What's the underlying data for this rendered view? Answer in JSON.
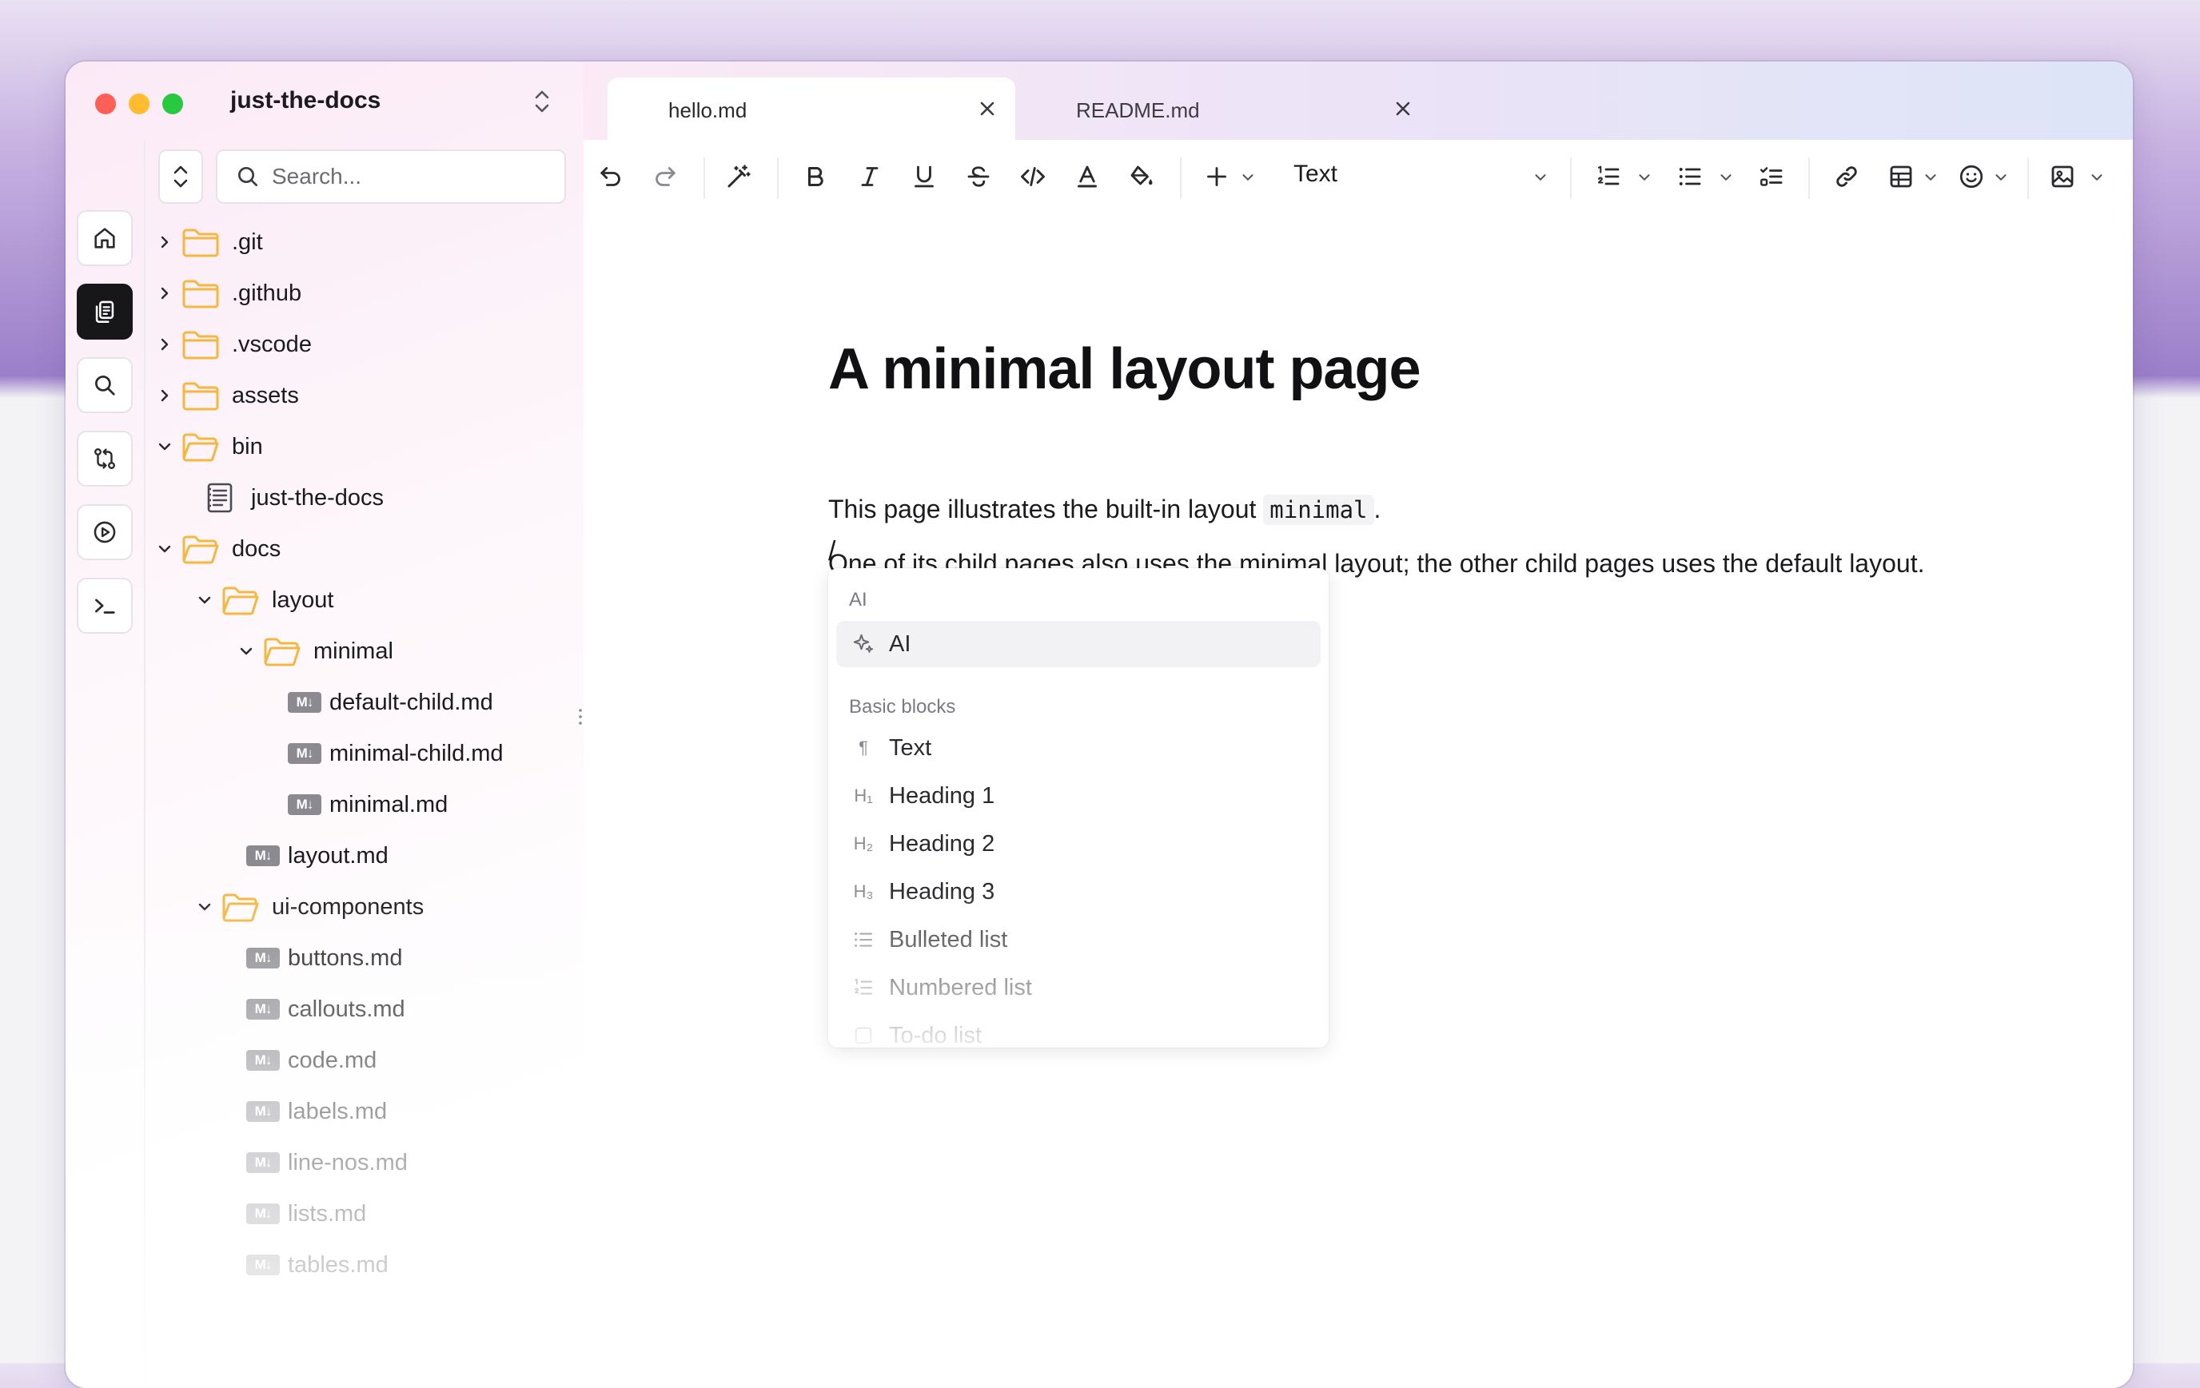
{
  "workspace": {
    "name": "just-the-docs"
  },
  "search": {
    "placeholder": "Search..."
  },
  "tree": [
    {
      "label": ".git",
      "type": "folder",
      "expanded": false
    },
    {
      "label": ".github",
      "type": "folder",
      "expanded": false
    },
    {
      "label": ".vscode",
      "type": "folder",
      "expanded": false
    },
    {
      "label": "assets",
      "type": "folder",
      "expanded": false
    },
    {
      "label": "bin",
      "type": "folder",
      "expanded": true
    },
    {
      "label": "just-the-docs",
      "type": "file"
    },
    {
      "label": "docs",
      "type": "folder",
      "expanded": true
    },
    {
      "label": "layout",
      "type": "folder",
      "expanded": true
    },
    {
      "label": "minimal",
      "type": "folder",
      "expanded": true
    },
    {
      "label": "default-child.md",
      "type": "md"
    },
    {
      "label": "minimal-child.md",
      "type": "md"
    },
    {
      "label": "minimal.md",
      "type": "md"
    },
    {
      "label": "layout.md",
      "type": "md"
    },
    {
      "label": "ui-components",
      "type": "folder",
      "expanded": true
    },
    {
      "label": "buttons.md",
      "type": "md"
    },
    {
      "label": "callouts.md",
      "type": "md"
    },
    {
      "label": "code.md",
      "type": "md"
    },
    {
      "label": "labels.md",
      "type": "md"
    },
    {
      "label": "line-nos.md",
      "type": "md"
    },
    {
      "label": "lists.md",
      "type": "md"
    },
    {
      "label": "tables.md",
      "type": "md"
    }
  ],
  "md_badge": "M↓",
  "tabs": [
    {
      "label": "hello.md",
      "active": true
    },
    {
      "label": "README.md",
      "active": false
    }
  ],
  "toolbar": {
    "block_type": "Text"
  },
  "document": {
    "title": "A minimal layout page",
    "p1_before": "This page illustrates the built-in layout ",
    "p1_code": "minimal",
    "p1_after": ".",
    "p2": "One of its child pages also uses the minimal layout; the other child pages uses the default layout.",
    "slash": "/"
  },
  "slash_menu": {
    "group_ai": "AI",
    "ai_item": "AI",
    "group_basic": "Basic blocks",
    "items": [
      {
        "label": "Text",
        "icon": "¶"
      },
      {
        "label": "Heading 1",
        "icon": "H₁"
      },
      {
        "label": "Heading 2",
        "icon": "H₂"
      },
      {
        "label": "Heading 3",
        "icon": "H₃"
      },
      {
        "label": "Bulleted list",
        "icon": "bulleted-list-icon"
      },
      {
        "label": "Numbered list",
        "icon": "numbered-list-icon"
      },
      {
        "label": "To-do list",
        "icon": "checkbox-icon"
      }
    ]
  },
  "colors": {
    "folder": "#f4b73f",
    "accent_dark": "#17171a",
    "md_badge": "#8a8a90"
  }
}
